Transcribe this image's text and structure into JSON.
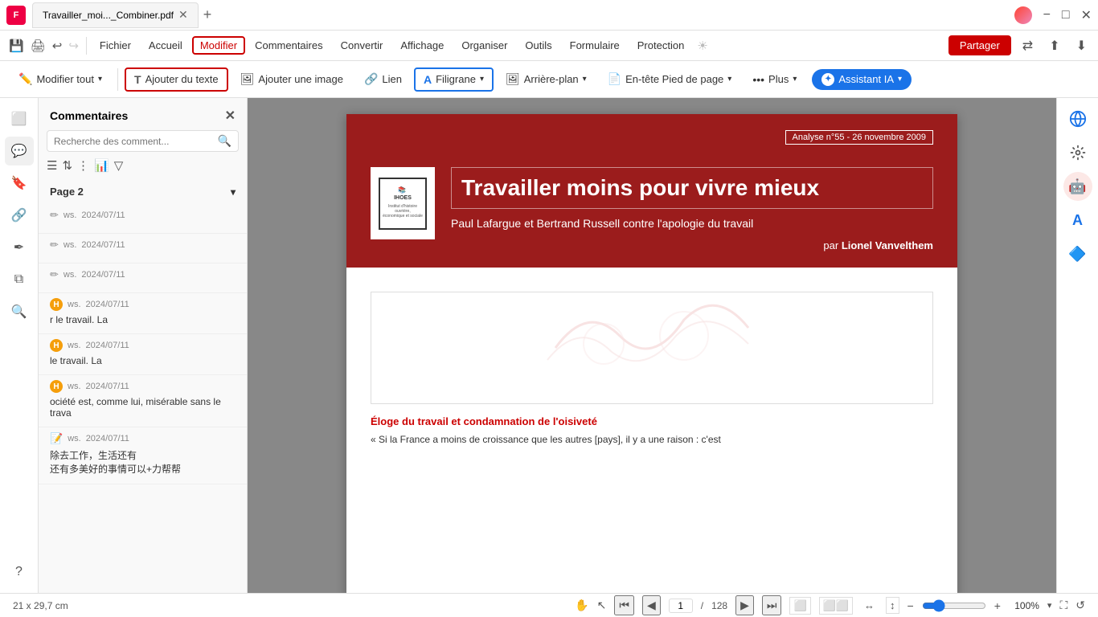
{
  "titlebar": {
    "tab_label": "Travailler_moi..._Combiner.pdf",
    "add_tab": "+",
    "win_minimize": "−",
    "win_restore": "□",
    "win_close": "✕"
  },
  "menubar": {
    "items": [
      {
        "id": "fichier",
        "label": "Fichier"
      },
      {
        "id": "accueil",
        "label": "Accueil"
      },
      {
        "id": "modifier",
        "label": "Modifier",
        "active": true
      },
      {
        "id": "commentaires",
        "label": "Commentaires"
      },
      {
        "id": "convertir",
        "label": "Convertir"
      },
      {
        "id": "affichage",
        "label": "Affichage"
      },
      {
        "id": "organiser",
        "label": "Organiser"
      },
      {
        "id": "outils",
        "label": "Outils"
      },
      {
        "id": "formulaire",
        "label": "Formulaire"
      },
      {
        "id": "protection",
        "label": "Protection"
      }
    ],
    "share_label": "Partager"
  },
  "toolbar": {
    "modifier_tout_label": "Modifier tout",
    "ajouter_texte_label": "Ajouter du texte",
    "ajouter_image_label": "Ajouter une image",
    "lien_label": "Lien",
    "filigrane_label": "Filigrane",
    "arriere_plan_label": "Arrière-plan",
    "entete_pied_label": "En-tête  Pied de page",
    "plus_label": "Plus",
    "ai_label": "Assistant IA"
  },
  "comments": {
    "title": "Commentaires",
    "search_placeholder": "Recherche des comment...",
    "page_label": "Page 2",
    "items": [
      {
        "type": "pencil",
        "author": "ws",
        "date": "2024/07/11",
        "text": "",
        "color": "#1a73e8"
      },
      {
        "type": "pencil",
        "author": "ws",
        "date": "2024/07/11",
        "text": "",
        "color": "#1a73e8"
      },
      {
        "type": "pencil",
        "author": "ws",
        "date": "2024/07/11",
        "text": "",
        "color": "#1a73e8"
      },
      {
        "type": "H",
        "author": "ws",
        "date": "2024/07/11",
        "text": "r le travail. La",
        "color": "#f59e0b"
      },
      {
        "type": "H",
        "author": "ws",
        "date": "2024/07/11",
        "text": "le travail. La",
        "color": "#f59e0b"
      },
      {
        "type": "H",
        "author": "ws",
        "date": "2024/07/11",
        "text": "ociété est, comme lui, misérable sans le trava",
        "color": "#f59e0b"
      },
      {
        "type": "doc",
        "author": "ws",
        "date": "2024/07/11",
        "text": "除去工作，生活还有\n还有多美好的事情可以+力帮帮",
        "color": "#1a73e8"
      }
    ]
  },
  "pdf": {
    "analysis_tag": "Analyse n°55 - 26 novembre 2009",
    "title": "Travailler moins pour vivre mieux",
    "subtitle": "Paul Lafargue et Bertrand Russell contre l'apologie du travail",
    "author_prefix": "par",
    "author": "Lionel Vanvelthem",
    "section_title": "Éloge du travail et condamnation de l'oisiveté",
    "section_text": "« Si la France a moins de croissance que les autres [pays], il y a une raison : c'est"
  },
  "statusbar": {
    "dimensions": "21 x 29,7 cm",
    "current_page": "1",
    "total_pages": "128",
    "zoom": "100%"
  }
}
